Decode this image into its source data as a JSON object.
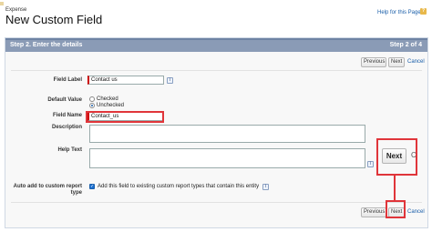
{
  "header": {
    "breadcrumb": "Expense",
    "title": "New Custom Field",
    "help_link": "Help for this Page",
    "help_icon": "?"
  },
  "step": {
    "title": "Step 2. Enter the details",
    "count": "Step 2 of 4"
  },
  "buttons": {
    "previous": "Previous",
    "next": "Next",
    "cancel": "Cancel",
    "next_highlight": "Next",
    "partial_c": "C"
  },
  "form": {
    "field_label": {
      "label": "Field Label",
      "value": "Contact us"
    },
    "default_value": {
      "label": "Default Value",
      "options": [
        "Checked",
        "Unchecked"
      ],
      "selected": "Unchecked"
    },
    "field_name": {
      "label": "Field Name",
      "value": "Contact_us"
    },
    "description": {
      "label": "Description"
    },
    "help_text": {
      "label": "Help Text"
    },
    "auto_add": {
      "label": "Auto add to custom report type",
      "checkbox_text": "Add this field to existing custom report types that contain this entity",
      "checked": true
    },
    "info_icon": "i"
  },
  "colors": {
    "step_bar": "#8a9bb6",
    "link": "#1a5ea9",
    "required": "#cc0000",
    "highlight": "#e0353a"
  }
}
